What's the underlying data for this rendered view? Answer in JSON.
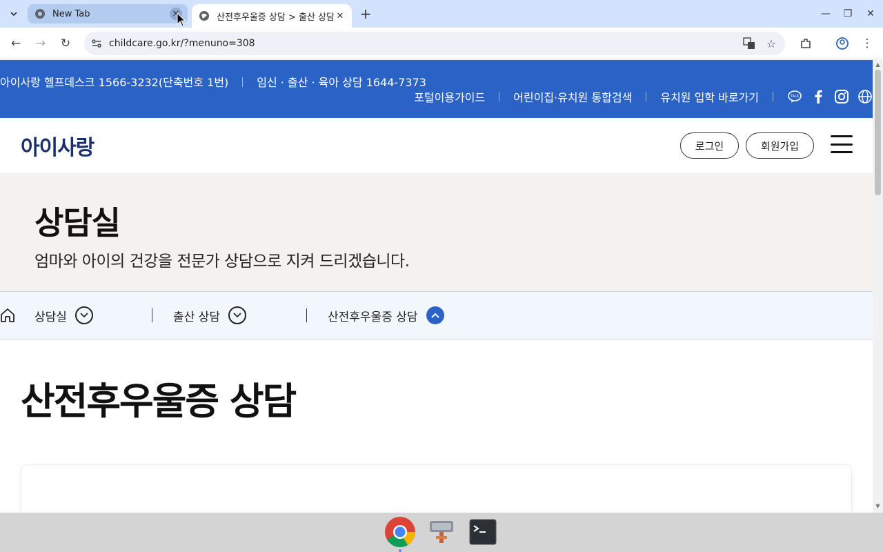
{
  "browser": {
    "tabs": [
      {
        "title": "New Tab",
        "active": false
      },
      {
        "title": "산전후우울증 상담 > 출산 상담",
        "active": true
      }
    ],
    "url": "childcare.go.kr/?menuno=308"
  },
  "topbar": {
    "helpdesk": "아이사랑 헬프데스크 1566-3232(단축번호 1번)",
    "consult_line": "임신 · 출산 · 육아 상담 1644-7373",
    "links": [
      "포털이용가이드",
      "어린이집·유치원 통합검색",
      "유치원 입학 바로가기"
    ],
    "sns_icons": [
      "kakaotalk-icon",
      "facebook-icon",
      "instagram-icon",
      "globe-icon"
    ]
  },
  "header": {
    "logo": "아이사랑",
    "login_label": "로그인",
    "signup_label": "회원가입"
  },
  "hero": {
    "title": "상담실",
    "description": "엄마와 아이의 건강을 전문가 상담으로 지켜 드리겠습니다."
  },
  "breadcrumb": {
    "items": [
      "상담실",
      "출산 상담",
      "산전후우울증 상담"
    ]
  },
  "content": {
    "title": "산전후우울증 상담"
  },
  "colors": {
    "brand_blue": "#2b62c6",
    "hero_bg": "#f4f1ee",
    "crumb_bg": "#f2f6fd"
  }
}
